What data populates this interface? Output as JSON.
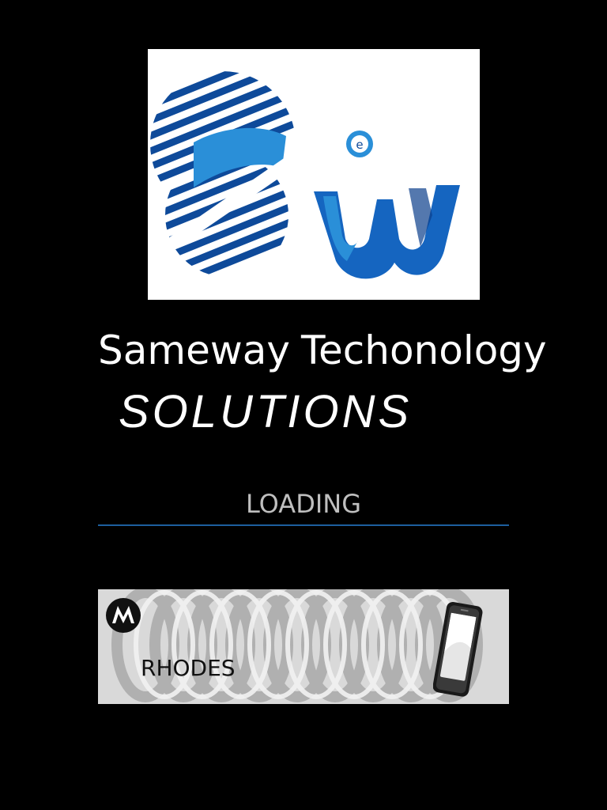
{
  "splash": {
    "company_name_part1": "Sameway",
    "company_name_part2": "Techonology",
    "company_tagline": "SOLUTIONS",
    "loading_label": "LOADING",
    "loading_progress": 0
  },
  "banner": {
    "label": "RHODES",
    "brand_icon": "motorola-logo-icon",
    "device_icon": "smartphone-icon"
  },
  "colors": {
    "background": "#000000",
    "logo_blue_dark": "#0b3f8c",
    "logo_blue_light": "#2a8fd8",
    "progress_line": "#1d5f9e",
    "loading_text": "#bfbfbf"
  }
}
